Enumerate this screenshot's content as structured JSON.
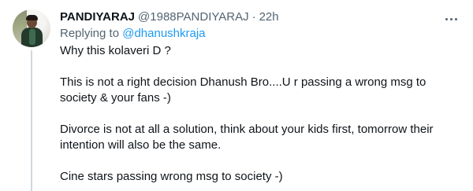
{
  "tweet": {
    "display_name": "PANDIYARAJ",
    "handle": "@1988PANDIYARAJ",
    "separator": "·",
    "time": "22h",
    "more_icon": "more-horizontal-icon",
    "replying_prefix": "Replying to ",
    "replying_to": "@dhanushkraja",
    "paragraphs": [
      "Why this kolaveri D ?",
      "This is not a right decision Dhanush Bro....U r passing a wrong msg to society & your fans -)",
      "Divorce is not at all a solution, think about your kids first, tomorrow their intention will also be the same.",
      "Cine stars passing wrong msg to society -)"
    ]
  },
  "colors": {
    "text": "#0f1419",
    "secondary": "#536471",
    "link": "#1d9bf0",
    "thread_line": "#cfd9de"
  }
}
